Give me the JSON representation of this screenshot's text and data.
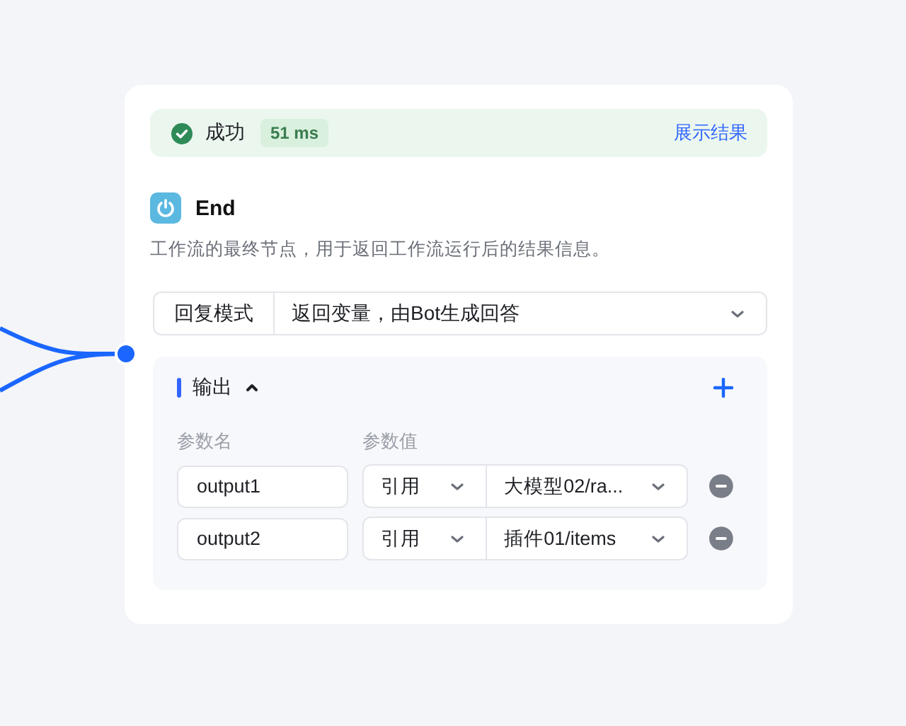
{
  "status": {
    "label": "成功",
    "duration": "51 ms",
    "link": "展示结果"
  },
  "node": {
    "title": "End",
    "description": "工作流的最终节点，用于返回工作流运行后的结果信息。"
  },
  "reply_mode": {
    "label": "回复模式",
    "value": "返回变量，由Bot生成回答"
  },
  "output": {
    "title": "输出",
    "expanded": true,
    "columns": [
      "参数名",
      "参数值"
    ],
    "params": [
      {
        "name": "output1",
        "type": "引用",
        "value": "大模型02/ra..."
      },
      {
        "name": "output2",
        "type": "引用",
        "value": "插件01/items"
      }
    ]
  }
}
